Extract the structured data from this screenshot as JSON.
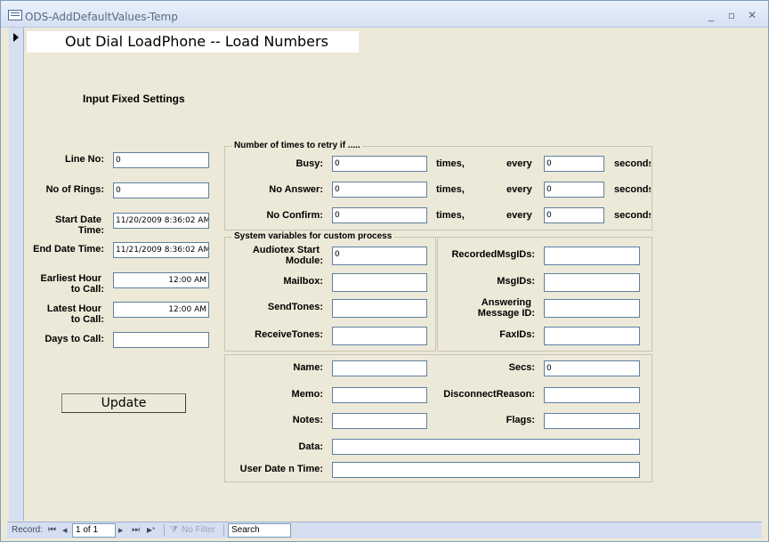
{
  "window": {
    "title": "ODS-AddDefaultValues-Temp",
    "minimize": "_",
    "restore": "▫",
    "close": "✕"
  },
  "header": {
    "title": "Out Dial LoadPhone -- Load Numbers"
  },
  "section_title": "Input Fixed Settings",
  "left": {
    "line_no": {
      "label": "Line No:",
      "value": "0"
    },
    "rings": {
      "label": "No of Rings:",
      "value": "0"
    },
    "start": {
      "label1": "Start Date",
      "label2": "Time:",
      "value": "11/20/2009 8:36:02 AM"
    },
    "end": {
      "label": "End Date Time:",
      "value": "11/21/2009 8:36:02 AM"
    },
    "earliest": {
      "label1": "Earliest Hour",
      "label2": "to Call:",
      "value": "12:00 AM"
    },
    "latest": {
      "label1": "Latest Hour",
      "label2": "to Call:",
      "value": "12:00 AM"
    },
    "days": {
      "label": "Days to Call:",
      "value": ""
    },
    "update_label": "Update"
  },
  "retry": {
    "caption": "Number of times to retry if .....",
    "rows": [
      {
        "label": "Busy:",
        "value": "0",
        "times": "times,",
        "every": "every",
        "secs": "0",
        "unit": "seconds"
      },
      {
        "label": "No Answer:",
        "value": "0",
        "times": "times,",
        "every": "every",
        "secs": "0",
        "unit": "seconds"
      },
      {
        "label": "No Confirm:",
        "value": "0",
        "times": "times,",
        "every": "every",
        "secs": "0",
        "unit": "seconds"
      }
    ]
  },
  "sysvars": {
    "caption": "System variables for custom process",
    "audiotex": {
      "label1": "Audiotex Start",
      "label2": "Module:",
      "value": "0"
    },
    "mailbox": {
      "label": "Mailbox:",
      "value": ""
    },
    "sendtones": {
      "label": "SendTones:",
      "value": ""
    },
    "receivetones": {
      "label": "ReceiveTones:",
      "value": ""
    },
    "recordedmsgids": {
      "label": "RecordedMsgIDs:",
      "value": ""
    },
    "msgids": {
      "label": "MsgIDs:",
      "value": ""
    },
    "answering": {
      "label1": "Answering",
      "label2": "Message ID:",
      "value": ""
    },
    "faxids": {
      "label": "FaxIDs:",
      "value": ""
    }
  },
  "misc": {
    "name": {
      "label": "Name:",
      "value": ""
    },
    "memo": {
      "label": "Memo:",
      "value": ""
    },
    "notes": {
      "label": "Notes:",
      "value": ""
    },
    "secs": {
      "label": "Secs:",
      "value": "0"
    },
    "disconnect": {
      "label": "DisconnectReason:",
      "value": ""
    },
    "flags": {
      "label": "Flags:",
      "value": ""
    },
    "data": {
      "label": "Data:",
      "value": ""
    },
    "userdate": {
      "label": "User Date n Time:",
      "value": ""
    }
  },
  "navbar": {
    "record_label": "Record:",
    "first": "⏮",
    "prev": "◀",
    "position": "1 of 1",
    "next": "▶",
    "last": "⏭",
    "new": "▶*",
    "filter": "No Filter",
    "search": "Search"
  }
}
